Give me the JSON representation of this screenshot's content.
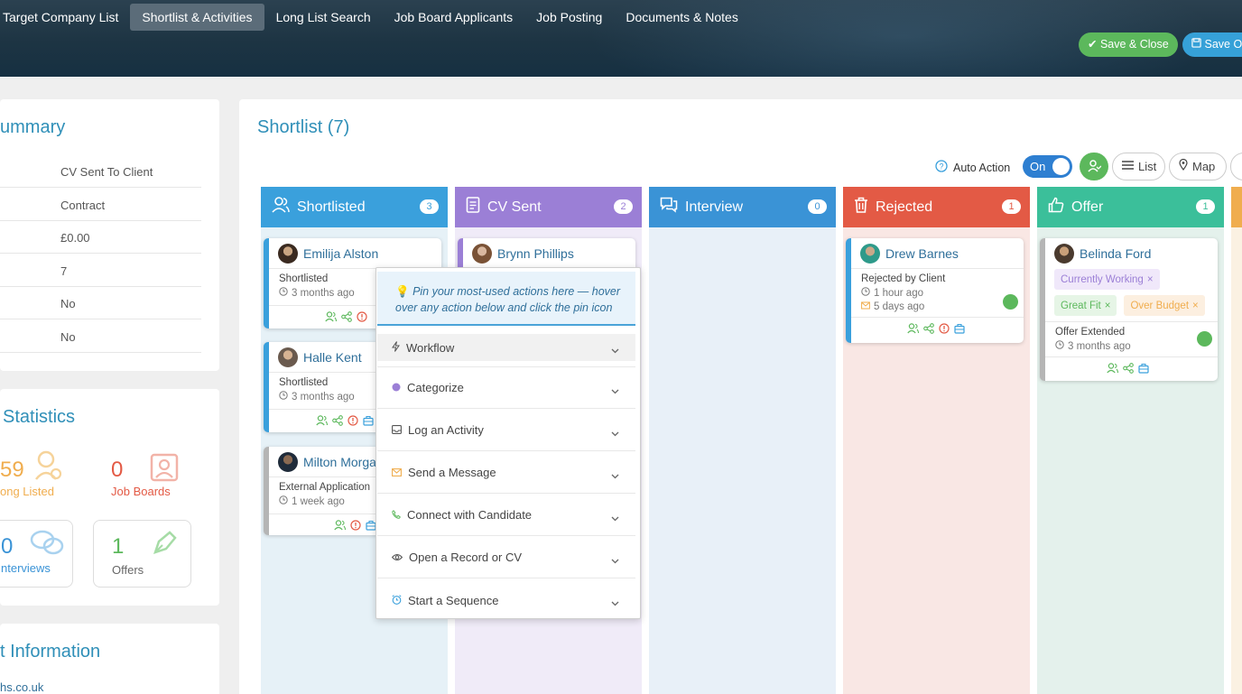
{
  "nav": {
    "items": [
      "Target Company List",
      "Shortlist & Activities",
      "Long List Search",
      "Job Board Applicants",
      "Job Posting",
      "Documents & Notes"
    ],
    "active": "Shortlist & Activities"
  },
  "header_buttons": {
    "save_close": "Save & Close",
    "save_only": "Save Or"
  },
  "summary": {
    "title": "ummary",
    "rows": [
      "CV Sent To Client",
      "Contract",
      "£0.00",
      "7",
      "No",
      "No"
    ]
  },
  "stats": {
    "title": "Statistics",
    "long_listed": {
      "value": "59",
      "label": "ong Listed"
    },
    "job_boards": {
      "value": "0",
      "label": "Job Boards"
    },
    "interviews": {
      "value": "0",
      "label": "nterviews"
    },
    "offers": {
      "value": "1",
      "label": "Offers"
    }
  },
  "info": {
    "title": "t Information",
    "link": "hs.co.uk"
  },
  "shortlist": {
    "title": "Shortlist (7)",
    "auto_action_label": "Auto Action",
    "toggle_label": "On",
    "list_label": "List",
    "map_label": "Map"
  },
  "columns": [
    {
      "title": "Shortlisted",
      "count": "3",
      "color": "#3aa0dc",
      "bg": "#e6f1f7"
    },
    {
      "title": "CV Sent",
      "count": "2",
      "color": "#9b7fd6",
      "bg": "#f0ebf8"
    },
    {
      "title": "Interview",
      "count": "0",
      "color": "#3a93d6",
      "bg": "#e8f0f8"
    },
    {
      "title": "Rejected",
      "count": "1",
      "color": "#e35a45",
      "bg": "#f9e7e4"
    },
    {
      "title": "Offer",
      "count": "1",
      "color": "#3bbf9a",
      "bg": "#e4f1ec"
    }
  ],
  "cards": {
    "emilija": {
      "name": "Emilija Alston",
      "status": "Shortlisted",
      "time": "3 months ago"
    },
    "halle": {
      "name": "Halle Kent",
      "status": "Shortlisted",
      "time": "3 months ago"
    },
    "milton": {
      "name": "Milton Morga",
      "status": "External Application",
      "time": "1 week ago"
    },
    "brynn": {
      "name": "Brynn Phillips"
    },
    "drew": {
      "name": "Drew Barnes",
      "status": "Rejected by Client",
      "time": "1 hour ago",
      "time2": "5 days ago"
    },
    "belinda": {
      "name": "Belinda Ford",
      "tags": [
        "Currently Working",
        "Great Fit",
        "Over Budget"
      ],
      "status": "Offer Extended",
      "time": "3 months ago"
    }
  },
  "popup": {
    "hint": "Pin your most-used actions here — hover over any action below and click the pin icon",
    "items": [
      "Workflow",
      "Categorize",
      "Log an Activity",
      "Send a Message",
      "Connect with Candidate",
      "Open a Record or CV",
      "Start a Sequence"
    ]
  },
  "colors": {
    "accent": "#2f8fb8",
    "green": "#5cb85c",
    "blue": "#36a1d8"
  }
}
